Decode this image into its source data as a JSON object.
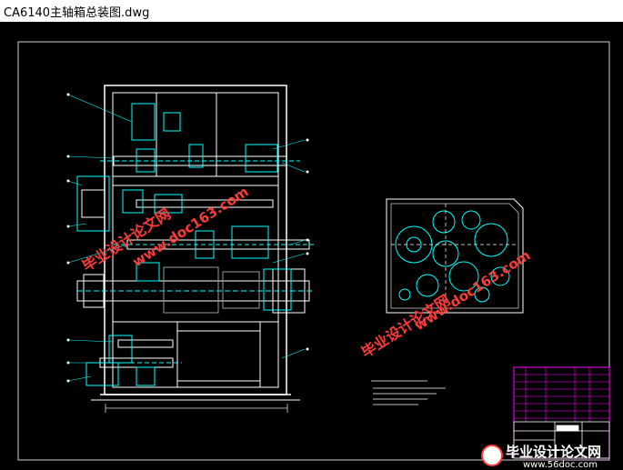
{
  "window": {
    "title": "CA6140主轴箱总装图.dwg"
  },
  "watermarks": {
    "cn_label": "毕业设计论文网",
    "domain_a": "www.doc163.com",
    "domain_b": "www.56doc.com"
  },
  "footer_logo": {
    "cn": "毕业设计论文网",
    "url": "www.56doc.com"
  },
  "colors": {
    "canvas_bg": "#000000",
    "line_white": "#ffffff",
    "line_cyan": "#00ffff",
    "line_magenta": "#ff00ff",
    "line_gray": "#9a9a9a",
    "watermark_red": "#ff3a3a"
  }
}
